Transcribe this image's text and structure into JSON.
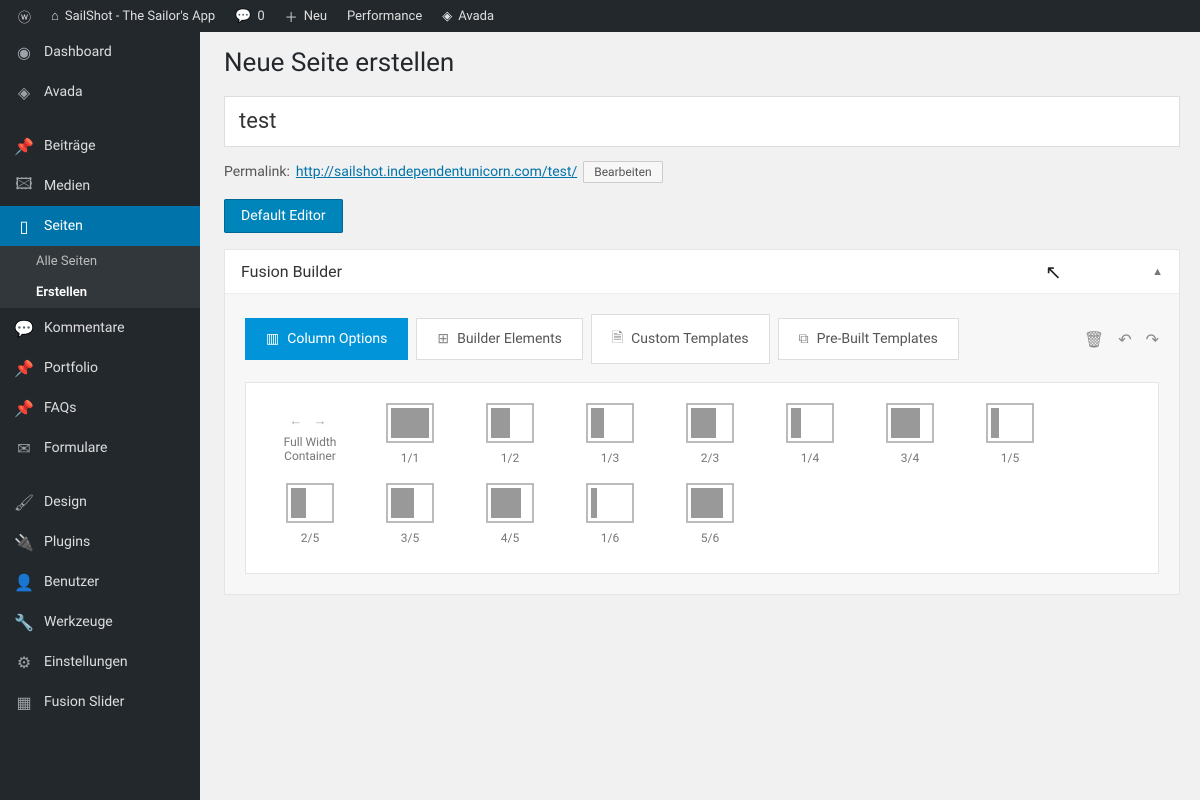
{
  "adminbar": {
    "site_title": "SailShot - The Sailor's App",
    "comments_count": "0",
    "neu": "Neu",
    "performance": "Performance",
    "avada": "Avada"
  },
  "sidebar": {
    "items": [
      {
        "icon": "dashboard",
        "label": "Dashboard"
      },
      {
        "icon": "avada",
        "label": "Avada"
      },
      {
        "icon": "pin",
        "label": "Beiträge"
      },
      {
        "icon": "media",
        "label": "Medien"
      },
      {
        "icon": "pages",
        "label": "Seiten",
        "current": true
      },
      {
        "icon": "comment",
        "label": "Kommentare"
      },
      {
        "icon": "pin",
        "label": "Portfolio"
      },
      {
        "icon": "pin",
        "label": "FAQs"
      },
      {
        "icon": "mail",
        "label": "Formulare"
      },
      {
        "icon": "brush",
        "label": "Design"
      },
      {
        "icon": "plugin",
        "label": "Plugins"
      },
      {
        "icon": "user",
        "label": "Benutzer"
      },
      {
        "icon": "wrench",
        "label": "Werkzeuge"
      },
      {
        "icon": "settings",
        "label": "Einstellungen"
      },
      {
        "icon": "slider",
        "label": "Fusion Slider"
      }
    ],
    "submenu_pages": {
      "all": "Alle Seiten",
      "create": "Erstellen"
    }
  },
  "page": {
    "heading": "Neue Seite erstellen",
    "title_value": "test",
    "permalink_label": "Permalink:",
    "permalink_url": "http://sailshot.independentunicorn.com/test/",
    "edit_btn": "Bearbeiten",
    "default_editor_btn": "Default Editor"
  },
  "fusion": {
    "panel_title": "Fusion Builder",
    "tabs": {
      "column_options": "Column Options",
      "builder_elements": "Builder Elements",
      "custom_templates": "Custom Templates",
      "prebuilt_templates": "Pre-Built Templates"
    },
    "fullwidth_label": "Full Width Container",
    "columns": [
      {
        "label": "1/1",
        "fill": 100
      },
      {
        "label": "1/2",
        "fill": 50
      },
      {
        "label": "1/3",
        "fill": 33
      },
      {
        "label": "2/3",
        "fill": 67
      },
      {
        "label": "1/4",
        "fill": 25
      },
      {
        "label": "3/4",
        "fill": 75
      },
      {
        "label": "1/5",
        "fill": 20
      },
      {
        "label": "2/5",
        "fill": 40
      },
      {
        "label": "3/5",
        "fill": 60
      },
      {
        "label": "4/5",
        "fill": 80
      },
      {
        "label": "1/6",
        "fill": 17
      },
      {
        "label": "5/6",
        "fill": 83
      }
    ]
  }
}
